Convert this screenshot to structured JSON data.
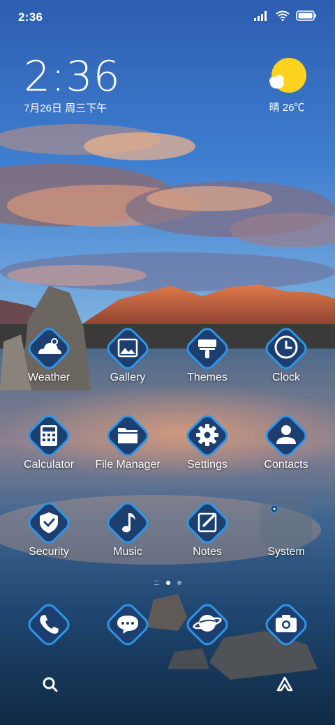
{
  "status_bar": {
    "time": "2:36",
    "icons": [
      "signal-icon",
      "wifi-icon",
      "battery-icon"
    ]
  },
  "clock_widget": {
    "time": "2:36",
    "date": "7月26日 周三下午"
  },
  "weather_widget": {
    "text": "晴 26℃",
    "icon": "sunny-cloud-icon"
  },
  "apps": [
    {
      "label": "Weather",
      "icon": "weather-icon"
    },
    {
      "label": "Gallery",
      "icon": "gallery-icon"
    },
    {
      "label": "Themes",
      "icon": "themes-icon"
    },
    {
      "label": "Clock",
      "icon": "clock-icon"
    },
    {
      "label": "Calculator",
      "icon": "calculator-icon"
    },
    {
      "label": "File Manager",
      "icon": "folder-icon"
    },
    {
      "label": "Settings",
      "icon": "gear-icon"
    },
    {
      "label": "Contacts",
      "icon": "contacts-icon"
    },
    {
      "label": "Security",
      "icon": "shield-icon"
    },
    {
      "label": "Music",
      "icon": "music-note-icon"
    },
    {
      "label": "Notes",
      "icon": "notes-icon"
    },
    {
      "label": "System",
      "icon": "folder"
    }
  ],
  "dock": [
    {
      "icon": "phone-icon"
    },
    {
      "icon": "message-icon"
    },
    {
      "icon": "browser-icon"
    },
    {
      "icon": "camera-icon"
    }
  ],
  "pages": {
    "count": 2,
    "current": 1
  },
  "bottom_bar": {
    "left": "search-icon",
    "right": "assistant-icon"
  },
  "colors": {
    "icon_border": "#2f95e8",
    "icon_fill": "#1d3f70",
    "sun": "#ffd21f"
  }
}
